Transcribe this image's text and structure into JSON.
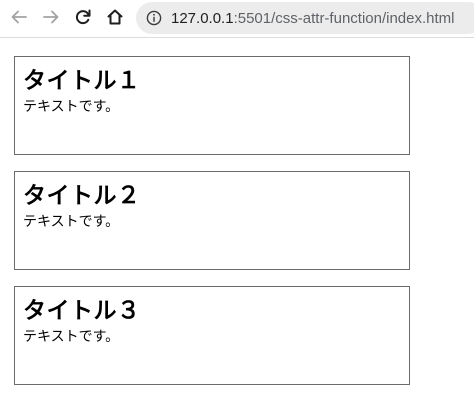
{
  "browser": {
    "url_host": "127.0.0.1",
    "url_path": ":5501/css-attr-function/index.html",
    "icons": {
      "back": "back-arrow-icon",
      "forward": "forward-arrow-icon",
      "reload": "reload-icon",
      "home": "home-icon",
      "info": "info-icon"
    }
  },
  "page": {
    "cards": [
      {
        "title": "タイトル１",
        "text": "テキストです。"
      },
      {
        "title": "タイトル２",
        "text": "テキストです。"
      },
      {
        "title": "タイトル３",
        "text": "テキストです。"
      }
    ]
  }
}
